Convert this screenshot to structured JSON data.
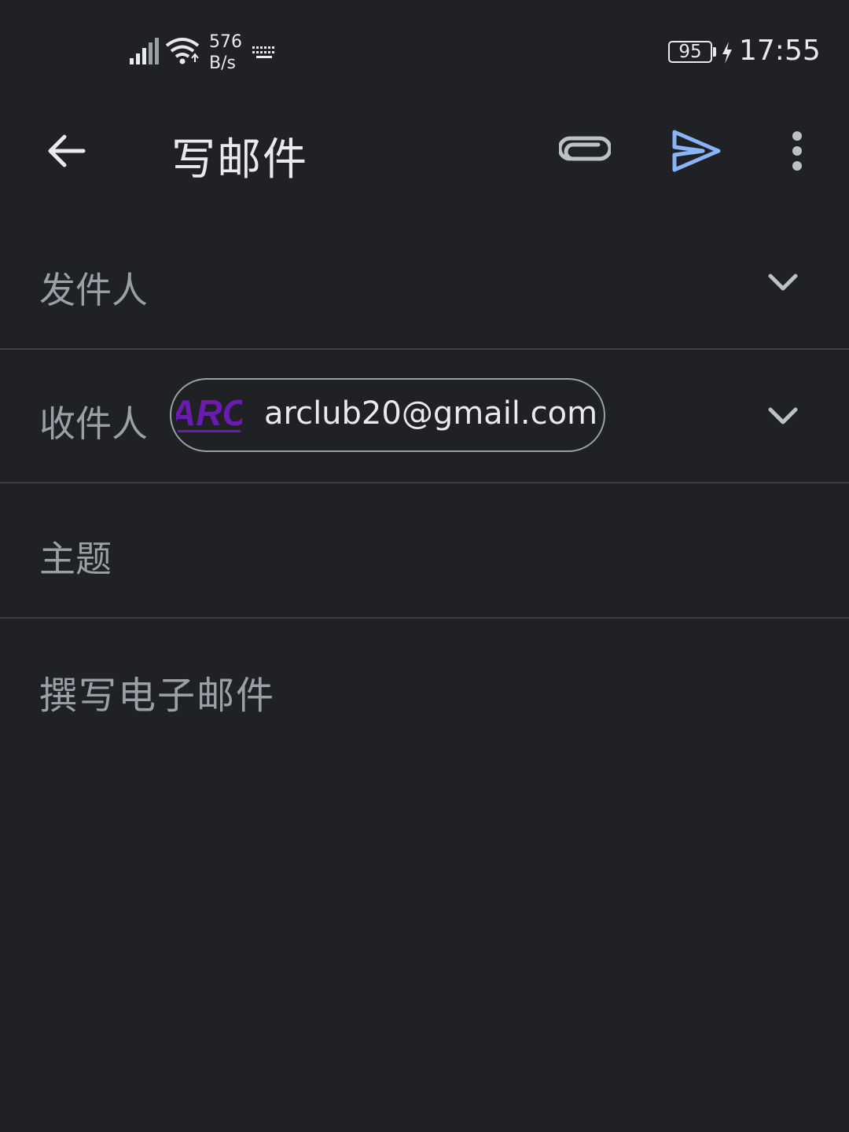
{
  "status_bar": {
    "net_speed_value": "576",
    "net_speed_unit": "B/s",
    "battery": "95",
    "time": "17:55",
    "icons": [
      "signal-icon",
      "wifi-icon",
      "keyboard-icon",
      "battery-icon",
      "charging-bolt-icon"
    ]
  },
  "app_bar": {
    "title": "写邮件",
    "icons": [
      "back-arrow-icon",
      "paperclip-icon",
      "send-icon",
      "more-vert-icon"
    ]
  },
  "form": {
    "from_label": "发件人",
    "to_label": "收件人",
    "recipient_chip": {
      "email": "arclub20@gmail.com",
      "avatar_text": "ARC"
    },
    "subject_label": "主题",
    "body_placeholder": "撰写电子邮件"
  },
  "colors": {
    "background": "#202124",
    "text_primary": "#e8eaed",
    "text_secondary": "#9aa0a6",
    "send_accent": "#8ab4f8",
    "divider": "#3c4043",
    "logo_purple": "#6a1bb0"
  }
}
